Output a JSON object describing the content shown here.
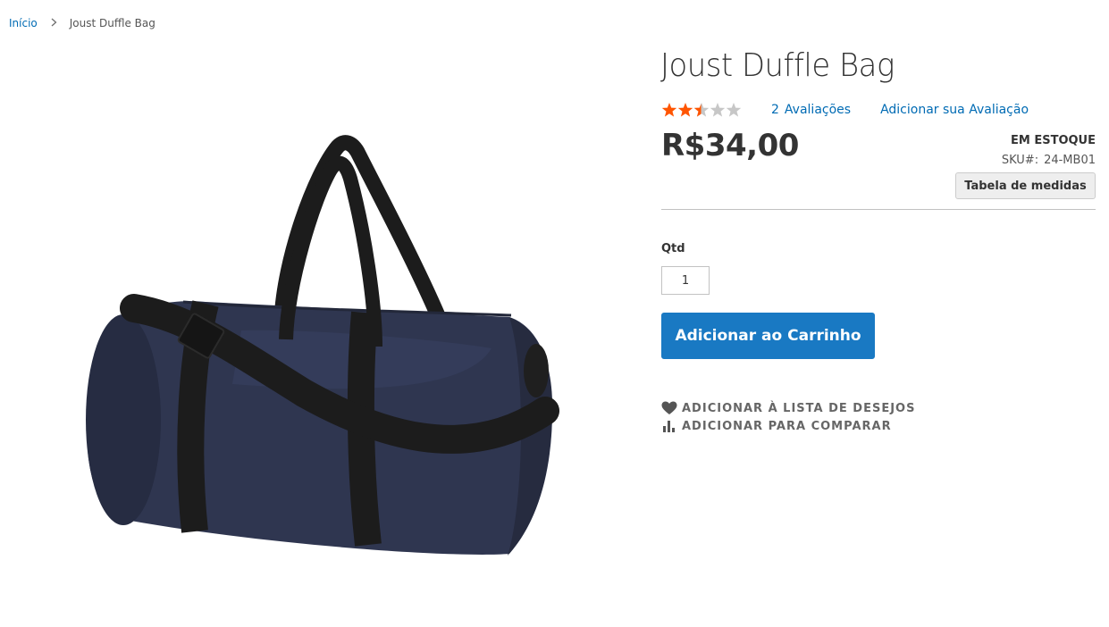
{
  "breadcrumbs": {
    "home": "Início",
    "separator": ">",
    "current": "Joust Duffle Bag"
  },
  "product": {
    "name": "Joust Duffle Bag",
    "rating": {
      "value": 2.5,
      "max": 5,
      "filled_color": "#ff5501",
      "empty_color": "#c7c7c7"
    },
    "reviews_count": "2",
    "reviews_label": "Avaliações",
    "add_review_label": "Adicionar sua Avaliação",
    "price": "R$34,00",
    "stock": "EM ESTOQUE",
    "sku_label": "SKU#:",
    "sku": "24-MB01",
    "size_chart_label": "Tabela de medidas",
    "qty_label": "Qtd",
    "qty_value": "1",
    "add_to_cart_label": "Adicionar ao Carrinho",
    "wishlist_label": "ADICIONAR À LISTA DE DESEJOS",
    "compare_label": "ADICIONAR PARA COMPARAR",
    "icons": {
      "wishlist": "heart-icon",
      "compare": "bar-chart-icon",
      "breadcrumb_separator": "chevron-right-icon"
    },
    "colors": {
      "link": "#006bb4",
      "primary_button": "#1979c3",
      "bag_body": "#2f3650",
      "bag_strap": "#1c1c1c"
    }
  }
}
